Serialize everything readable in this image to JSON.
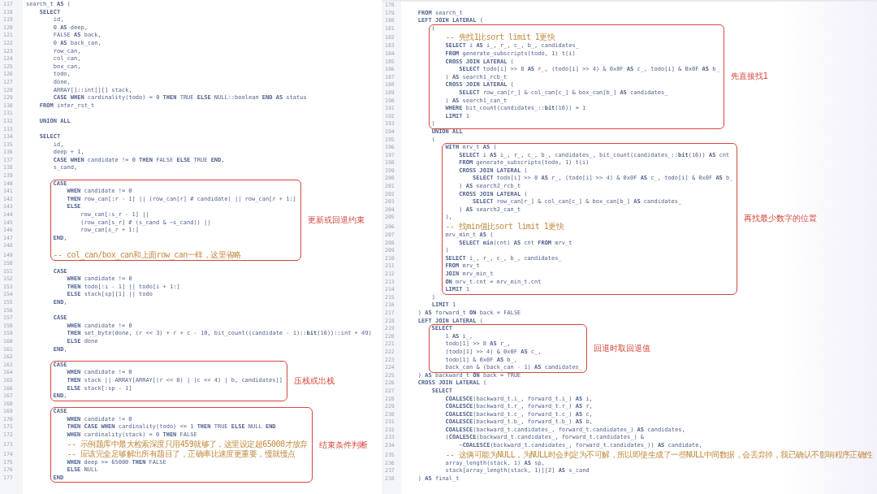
{
  "panels": [
    {
      "blocks": [
        {
          "kind": "plain",
          "lines": [
            {
              "n": "117",
              "code": "search_t **AS** ("
            },
            {
              "n": "118",
              "code": "    **SELECT**"
            },
            {
              "n": "119",
              "code": "        id,"
            },
            {
              "n": "120",
              "code": "        0 **AS** deep,"
            },
            {
              "n": "121",
              "code": "        FALSE **AS** back,"
            },
            {
              "n": "122",
              "code": "        0 **AS** back_can,"
            },
            {
              "n": "123",
              "code": "        row_can,"
            },
            {
              "n": "124",
              "code": "        col_can,"
            },
            {
              "n": "125",
              "code": "        box_can,"
            },
            {
              "n": "126",
              "code": "        todo,"
            },
            {
              "n": "127",
              "code": "        done,"
            },
            {
              "n": "128",
              "code": "        ARRAY[]::int[][] stack,"
            },
            {
              "n": "129",
              "code": "        **CASE WHEN** cardinality(todo) = 0 **THEN** TRUE **ELSE** NULL::boolean **END AS** status"
            },
            {
              "n": "130",
              "code": "    **FROM** infer_rst_t"
            },
            {
              "n": "131"
            },
            {
              "n": "132",
              "code": "    **UNION ALL**"
            },
            {
              "n": "133"
            },
            {
              "n": "134",
              "code": "    **SELECT**"
            },
            {
              "n": "135",
              "code": "        id,"
            },
            {
              "n": "136",
              "code": "        deep + 1,"
            },
            {
              "n": "137",
              "code": "        **CASE WHEN** candidate != 0 **THEN** FALSE **ELSE** TRUE **END**,"
            },
            {
              "n": "138",
              "code": "        s_cand,"
            },
            {
              "n": "139"
            }
          ]
        },
        {
          "kind": "boxed",
          "note": "更新或回退约束",
          "lines": [
            {
              "n": "140",
              "code": "        **CASE**"
            },
            {
              "n": "141",
              "code": "            **WHEN** candidate != 0"
            },
            {
              "n": "142",
              "code": "            **THEN** row_can[:r - 1] || (row_can[r] # candidate) || row_can[r + 1:]"
            },
            {
              "n": "143",
              "code": "            **ELSE**"
            },
            {
              "n": "144",
              "code": "                row_can[:s_r - 1] ||"
            },
            {
              "n": "145",
              "code": "                (row_can[s_r] # (s_cand & ~s_cand)) ||"
            },
            {
              "n": "146",
              "code": "                row_can[s_r + 1:]"
            },
            {
              "n": "147",
              "code": "        **END**,"
            },
            {
              "n": "148"
            },
            {
              "n": "149",
              "kind": "comment",
              "code": "        -- col_can/box_can和上面row_can一样，这里省略"
            }
          ]
        },
        {
          "kind": "plain",
          "lines": [
            {
              "n": "150"
            },
            {
              "n": "151",
              "code": "        **CASE**"
            },
            {
              "n": "152",
              "code": "            **WHEN** candidate != 0"
            },
            {
              "n": "153",
              "code": "            **THEN** todo[:i - 1] || todo[i + 1:]"
            },
            {
              "n": "154",
              "code": "            **ELSE** stack[sp][1] || todo"
            },
            {
              "n": "155",
              "code": "        **END**,"
            },
            {
              "n": "156"
            },
            {
              "n": "157",
              "code": "        **CASE**"
            },
            {
              "n": "158",
              "code": "            **WHEN** candidate != 0"
            },
            {
              "n": "159",
              "code": "            **THEN** set_byte(done, (r << 3) + r + c - 10, bit_count((candidate - 1)::**bit**(16))::int + 49)"
            },
            {
              "n": "160",
              "code": "            **ELSE** done"
            },
            {
              "n": "161",
              "code": "        **END**,"
            },
            {
              "n": "162"
            }
          ]
        },
        {
          "kind": "boxed",
          "note": "压栈或出栈",
          "lines": [
            {
              "n": "163",
              "code": "        **CASE**"
            },
            {
              "n": "164",
              "code": "            **WHEN** candidate != 0"
            },
            {
              "n": "165",
              "code": "            **THEN** stack || ARRAY[ARRAY[(r << 8) | (c << 4) | b, candidates]]"
            },
            {
              "n": "166",
              "code": "            **ELSE** stack[:sp - 1]"
            },
            {
              "n": "167",
              "code": "        **END**,"
            }
          ]
        },
        {
          "kind": "plain",
          "lines": [
            {
              "n": "168"
            }
          ]
        },
        {
          "kind": "boxed",
          "note": "结束条件判断",
          "lines": [
            {
              "n": "169",
              "code": "        **CASE**"
            },
            {
              "n": "170",
              "code": "            **WHEN** candidate != 0"
            },
            {
              "n": "171",
              "code": "            **THEN CASE WHEN** cardinality(todo) <= 1 **THEN** TRUE **ELSE** NULL **END**"
            },
            {
              "n": "172",
              "code": "            **WHEN** cardinality(stack) = 0 **THEN** FALSE"
            },
            {
              "n": "173",
              "kind": "comment",
              "code": "            -- 示例题库中最大检索深度只用459就够了，这里设定超65000才放弃"
            },
            {
              "n": "174",
              "kind": "comment",
              "code": "            -- 应该完全足够解出所有题目了，正确率比速度更重要，慢就慢点"
            },
            {
              "n": "175",
              "code": "            **WHEN** deep >= 65000 **THEN** FALSE"
            },
            {
              "n": "176",
              "code": "            **ELSE** NULL"
            },
            {
              "n": "177",
              "code": "        **END**"
            }
          ]
        }
      ]
    },
    {
      "blocks": [
        {
          "kind": "plain",
          "lines": [
            {
              "n": "178"
            },
            {
              "n": "179",
              "code": "    **FROM** search_t"
            },
            {
              "n": "180",
              "code": "    **LEFT JOIN LATERAL** ("
            }
          ]
        },
        {
          "kind": "boxed",
          "note": "先直接找1",
          "lines": [
            {
              "n": "181",
              "code": "        ("
            },
            {
              "n": "182",
              "kind": "comment",
              "code": "            -- 先找1比sort limit 1更快"
            },
            {
              "n": "183",
              "code": "            **SELECT** i **AS** i_, r_, c_, b_, candidates_"
            },
            {
              "n": "184",
              "code": "            **FROM** generate_subscripts(todo, 1) t(i)"
            },
            {
              "n": "185",
              "code": "            **CROSS JOIN LATERAL** ("
            },
            {
              "n": "186",
              "code": "                **SELECT** todo[i] >> 8 **AS** r_, (todo[i] >> 4) & 0x0F **AS** c_, todo[i] & 0x0F **AS** b_"
            },
            {
              "n": "187",
              "code": "            ) **AS** search1_rcb_t"
            },
            {
              "n": "188",
              "code": "            **CROSS JOIN LATERAL** ("
            },
            {
              "n": "189",
              "code": "                **SELECT** row_can[r_] & col_can[c_] & box_can[b_] **AS** candidates_"
            },
            {
              "n": "190",
              "code": "            ) **AS** search1_can_t"
            },
            {
              "n": "191",
              "code": "            **WHERE** bit_count(candidates_::**bit**(16)) = 1"
            },
            {
              "n": "192",
              "code": "            **LIMIT** 1"
            },
            {
              "n": "193",
              "code": "        )"
            }
          ]
        },
        {
          "kind": "plain",
          "lines": [
            {
              "n": "194",
              "code": "        **UNION ALL**"
            },
            {
              "n": "195",
              "code": "        ("
            }
          ]
        },
        {
          "kind": "boxed",
          "note": "再找最少数字的位置",
          "lines": [
            {
              "n": "196",
              "code": "            **WITH** mrv_t **AS** ("
            },
            {
              "n": "197",
              "code": "                **SELECT** i **AS** i_, r_, c_, b_, candidates_, bit_count(candidates_::**bit**(16)) **AS** cnt"
            },
            {
              "n": "198",
              "code": "                **FROM** generate_subscripts(todo, 1) t(i)"
            },
            {
              "n": "199",
              "code": "                **CROSS JOIN LATERAL** ("
            },
            {
              "n": "200",
              "code": "                    **SELECT** todo[i] >> 8 **AS** r_, (todo[i] >> 4) & 0x0F **AS** c_, todo[i] & 0x0F **AS** b_"
            },
            {
              "n": "201",
              "code": "                ) **AS** search2_rcb_t"
            },
            {
              "n": "202",
              "code": "                **CROSS JOIN LATERAL** ("
            },
            {
              "n": "203",
              "code": "                    **SELECT** row_can[r_] & col_can[c_] & box_can[b_] **AS** candidates_"
            },
            {
              "n": "204",
              "code": "                ) **AS** search2_can_t"
            },
            {
              "n": "205",
              "code": "            ),"
            },
            {
              "n": "206",
              "kind": "comment",
              "code": "            -- 找min值比sort limit 1更快"
            },
            {
              "n": "207",
              "code": "            mrv_min_t **AS** ("
            },
            {
              "n": "208",
              "code": "                **SELECT min**(cnt) **AS** cnt **FROM** mrv_t"
            },
            {
              "n": "209",
              "code": "            )"
            },
            {
              "n": "210",
              "code": "            **SELECT** i_, r_, c_, b_, candidates_"
            },
            {
              "n": "211",
              "code": "            **FROM** mrv_t"
            },
            {
              "n": "212",
              "code": "            **JOIN** mrv_min_t"
            },
            {
              "n": "213",
              "code": "            **ON** mrv_t.cnt = mrv_min_t.cnt"
            },
            {
              "n": "214",
              "code": "            **LIMIT** 1"
            }
          ]
        },
        {
          "kind": "plain",
          "lines": [
            {
              "n": "215",
              "code": "        )"
            },
            {
              "n": "216",
              "code": "        **LIMIT** 1"
            },
            {
              "n": "217",
              "code": "    ) **AS** forward_t **ON** back = FALSE"
            },
            {
              "n": "218",
              "code": "    **LEFT JOIN LATERAL** ("
            }
          ]
        },
        {
          "kind": "boxed",
          "note": "回退时取回退值",
          "lines": [
            {
              "n": "219",
              "code": "        **SELECT**"
            },
            {
              "n": "220",
              "code": "            1 **AS** i_,"
            },
            {
              "n": "221",
              "code": "            todo[1] >> 8 **AS** r_,"
            },
            {
              "n": "222",
              "code": "            (todo[1] >> 4) & 0x0F **AS** c_,"
            },
            {
              "n": "223",
              "code": "            todo[1] & 0x0F **AS** b_,"
            },
            {
              "n": "224",
              "code": "            back_can & (back_can - 1) **AS** candidates_"
            }
          ]
        },
        {
          "kind": "plain",
          "lines": [
            {
              "n": "225",
              "code": "    ) **AS** backward_t **ON** back = TRUE"
            },
            {
              "n": "226",
              "code": "    **CROSS JOIN LATERAL** ("
            },
            {
              "n": "227",
              "code": "        **SELECT**"
            },
            {
              "n": "228",
              "code": "            **COALESCE**(backward_t.i_, forward_t.i_) **AS** i,"
            },
            {
              "n": "229",
              "code": "            **COALESCE**(backward_t.r_, forward_t.r_) **AS** r,"
            },
            {
              "n": "230",
              "code": "            **COALESCE**(backward_t.c_, forward_t.c_) **AS** c,"
            },
            {
              "n": "231",
              "code": "            **COALESCE**(backward_t.b_, forward_t.b_) **AS** b,"
            },
            {
              "n": "232",
              "code": "            **COALESCE**(backward_t.candidates_, forward_t.candidates_) **AS** candidates,"
            },
            {
              "n": "233",
              "code": "            (**COALESCE**(backward_t.candidates_, forward_t.candidates_) &"
            },
            {
              "n": "234",
              "code": "                ~**COALESCE**(backward_t.candidates_, forward_t.candidates_)) **AS** candidate,"
            },
            {
              "n": "235",
              "kind": "comment",
              "code": "            -- 这俩可能为NULL，为NULL时会判定为不可解，所以即使生成了一些NULL中间数据，会丢弃掉，我已确认不影响程序正确性"
            },
            {
              "n": "236",
              "code": "            array_length(stack, 1) **AS** sp,"
            },
            {
              "n": "237",
              "code": "            stack[array_length(stack, 1)][2] **AS** s_cand"
            },
            {
              "n": "238",
              "code": "    ) **AS** final_t"
            }
          ]
        }
      ]
    }
  ]
}
